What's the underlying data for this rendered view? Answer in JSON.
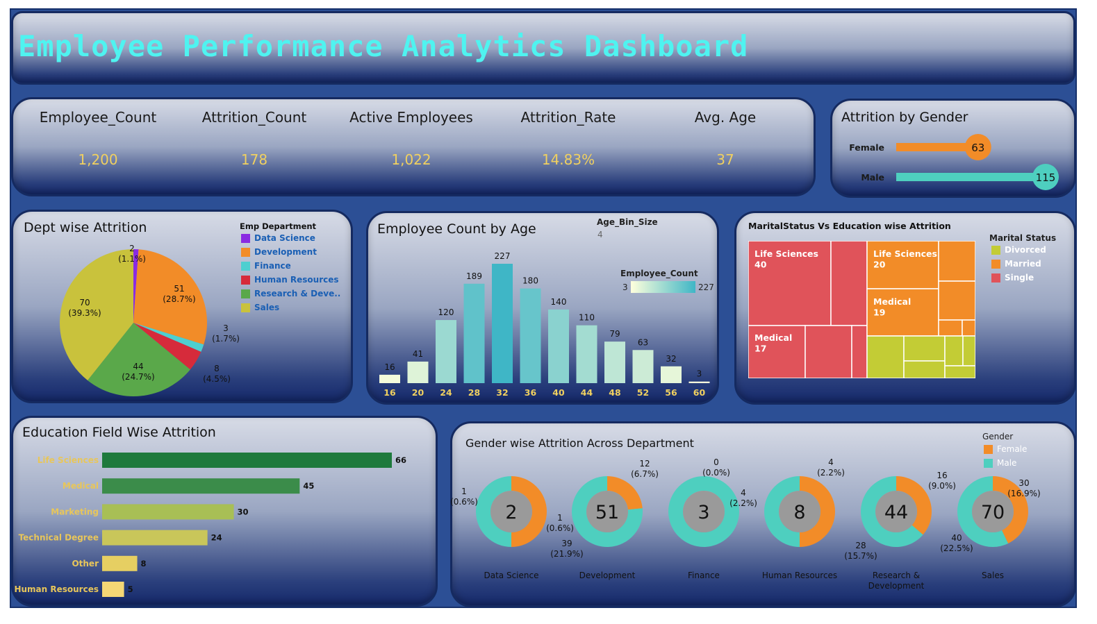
{
  "header": {
    "title": "Employee Performance Analytics Dashboard"
  },
  "kpis": [
    {
      "label": "Employee_Count",
      "value": "1,200"
    },
    {
      "label": "Attrition_Count",
      "value": "178"
    },
    {
      "label": "Active Employees",
      "value": "1,022"
    },
    {
      "label": "Attrition_Rate",
      "value": "14.83%"
    },
    {
      "label": "Avg. Age",
      "value": "37"
    }
  ],
  "colors": {
    "title": "#4ff3f0",
    "kpi_value": "#f0d060",
    "female": "#f28c28",
    "male": "#4ecfbf",
    "frame": "#2c4f95"
  },
  "gender_panel": {
    "title": "Attrition by Gender",
    "chart_data": {
      "type": "bar",
      "orientation": "horizontal",
      "categories": [
        "Female",
        "Male"
      ],
      "values": [
        63,
        115
      ],
      "colors": [
        "#f28c28",
        "#4ecfbf"
      ]
    }
  },
  "dept_panel": {
    "title": "Dept wise Attrition",
    "legend_title": "Emp Department",
    "chart_data": {
      "type": "pie",
      "categories": [
        "Data Science",
        "Development",
        "Finance",
        "Human Resources",
        "Research & Deve..",
        "Sales"
      ],
      "values": [
        2,
        51,
        3,
        8,
        44,
        70
      ],
      "percent_labels": [
        "(1.1%)",
        "(28.7%)",
        "(1.7%)",
        "(4.5%)",
        "(24.7%)",
        "(39.3%)"
      ],
      "colors": [
        "#8a2be2",
        "#f28c28",
        "#4ecfd0",
        "#d62b3b",
        "#5aa84a",
        "#c9c23c"
      ]
    }
  },
  "age_panel": {
    "title": "Employee Count by Age",
    "param_label": "Age_Bin_Size",
    "param_value": "4",
    "legend_title": "Employee_Count",
    "legend_min": "3",
    "legend_max": "227",
    "chart_data": {
      "type": "bar",
      "categories": [
        "16",
        "20",
        "24",
        "28",
        "32",
        "36",
        "40",
        "44",
        "48",
        "52",
        "56",
        "60"
      ],
      "values": [
        16,
        41,
        120,
        189,
        227,
        180,
        140,
        110,
        79,
        63,
        32,
        3
      ],
      "color_scale": [
        "#ffffdc",
        "#3fb6c6"
      ]
    }
  },
  "marital_panel": {
    "title": "MaritalStatus Vs Education wise Attrition",
    "legend_title": "Marital Status",
    "legend": [
      {
        "label": "Divorced",
        "color": "#c3cc35"
      },
      {
        "label": "Married",
        "color": "#f28c28"
      },
      {
        "label": "Single",
        "color": "#e0535a"
      }
    ],
    "chart_data": {
      "type": "treemap",
      "labeled_cells": [
        {
          "status": "Single",
          "education": "Life Sciences",
          "value": 40
        },
        {
          "status": "Single",
          "education": "Medical",
          "value": 17
        },
        {
          "status": "Married",
          "education": "Life Sciences",
          "value": 20
        },
        {
          "status": "Married",
          "education": "Medical",
          "value": 19
        }
      ]
    }
  },
  "edu_panel": {
    "title": "Education Field Wise Attrition",
    "chart_data": {
      "type": "bar",
      "orientation": "horizontal",
      "categories": [
        "Life Sciences",
        "Medical",
        "Marketing",
        "Technical Degree",
        "Other",
        "Human Resources"
      ],
      "values": [
        66,
        45,
        30,
        24,
        8,
        5
      ],
      "colors": [
        "#1e7a3c",
        "#3b8c4a",
        "#a8bf55",
        "#c9c65a",
        "#e6cf62",
        "#f5d775"
      ]
    }
  },
  "gender_dept_panel": {
    "title": "Gender wise Attrition Across Department",
    "legend_title": "Gender",
    "legend": [
      {
        "label": "Female",
        "color": "#f28c28"
      },
      {
        "label": "Male",
        "color": "#4ecfbf"
      }
    ],
    "chart_data": {
      "type": "pie",
      "subtype": "donut",
      "departments": [
        {
          "name": "Data Science",
          "total": 2,
          "female": 1,
          "male": 1,
          "female_label": "1\n(0.6%)",
          "male_label": ""
        },
        {
          "name": "Development",
          "total": 51,
          "female": 12,
          "male": 39,
          "female_label": "12\n(6.7%)",
          "male_label": "39\n(21.9%)"
        },
        {
          "name": "Finance",
          "total": 3,
          "female": 0,
          "male": 3,
          "female_label": "0\n(0.0%)",
          "male_label": ""
        },
        {
          "name": "Human Resources",
          "total": 8,
          "female": 4,
          "male": 4,
          "female_label": "4\n(2.2%)",
          "male_label": ""
        },
        {
          "name": "Research &\nDevelopment",
          "total": 44,
          "female": 16,
          "male": 28,
          "female_label": "16\n(9.0%)",
          "male_label": "28\n(15.7%)"
        },
        {
          "name": "Sales",
          "total": 70,
          "female": 30,
          "male": 40,
          "female_label": "30\n(16.9%)",
          "male_label": "40\n(22.5%)"
        }
      ],
      "extra_labels": [
        "1\n(0.6%)",
        "4\n(2.2%)"
      ]
    }
  }
}
